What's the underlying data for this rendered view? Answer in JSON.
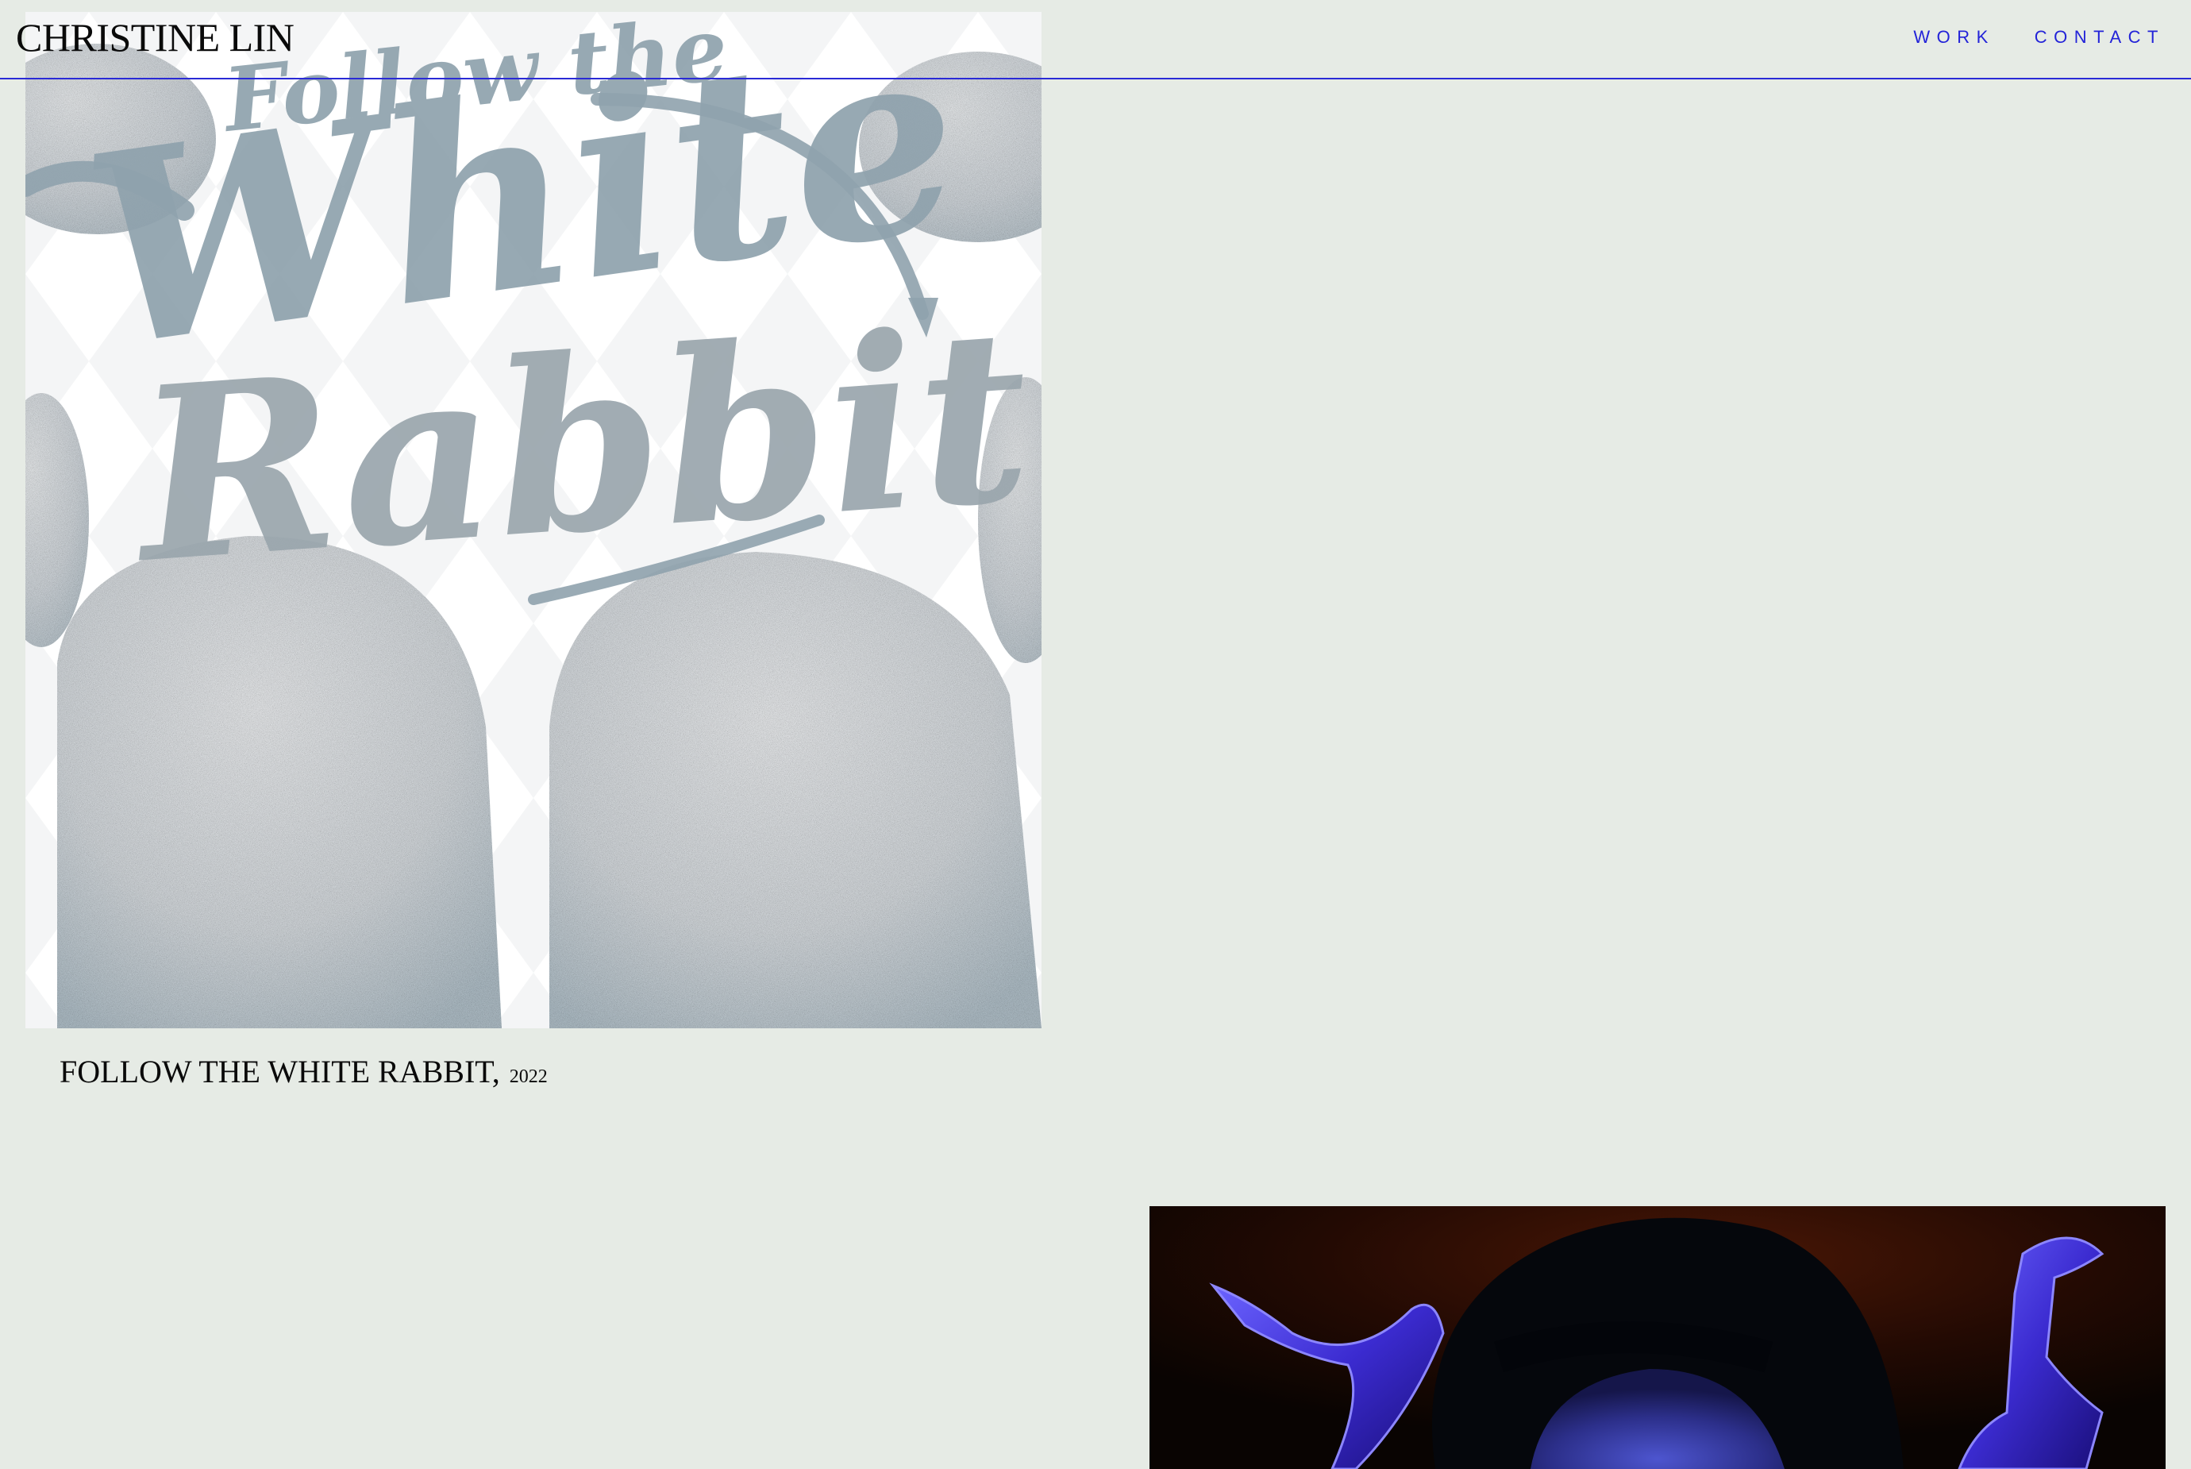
{
  "header": {
    "brand": "CHRISTINE LIN",
    "nav": [
      {
        "label": "WORK"
      },
      {
        "label": "CONTACT"
      }
    ]
  },
  "projects": [
    {
      "artwork_text_line1": "Follow the",
      "artwork_text_line2": "White",
      "artwork_text_line3": "Rabbit",
      "title": "FOLLOW THE WHITE RABBIT,",
      "year": "2022"
    },
    {
      "title": "",
      "year": ""
    }
  ],
  "colors": {
    "background": "#e6ebe5",
    "accent": "#2a2ad6",
    "text": "#0a0a0a"
  }
}
